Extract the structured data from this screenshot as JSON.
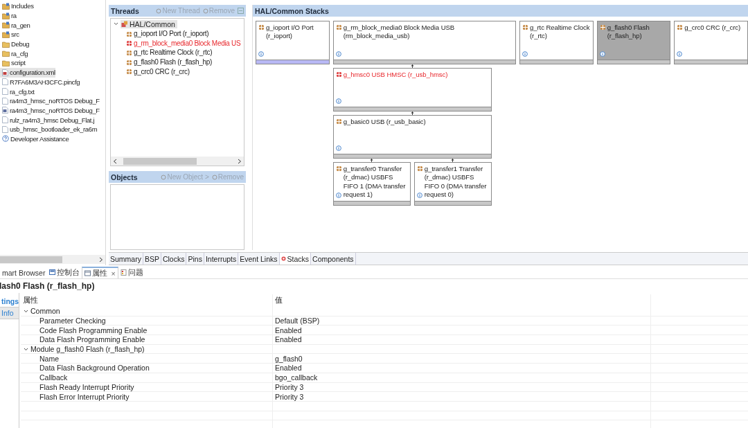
{
  "project_tree": {
    "items": [
      {
        "label": "Includes",
        "kind": "package-folder",
        "selected": false
      },
      {
        "label": "ra",
        "kind": "package-folder",
        "selected": false
      },
      {
        "label": "ra_gen",
        "kind": "package-folder",
        "selected": false
      },
      {
        "label": "src",
        "kind": "package-folder",
        "selected": false
      },
      {
        "label": "Debug",
        "kind": "folder",
        "selected": false
      },
      {
        "label": "ra_cfg",
        "kind": "folder",
        "selected": false
      },
      {
        "label": "script",
        "kind": "folder",
        "selected": false
      },
      {
        "label": "configuration.xml",
        "kind": "config-file",
        "selected": true
      },
      {
        "label": "R7FA6M3AH3CFC.pincfg",
        "kind": "file",
        "selected": false
      },
      {
        "label": "ra_cfg.txt",
        "kind": "file",
        "selected": false
      },
      {
        "label": "ra4m3_hmsc_noRTOS Debug_F",
        "kind": "file",
        "selected": false
      },
      {
        "label": "ra4m3_hmsc_noRTOS Debug_F",
        "kind": "launch-file",
        "selected": false
      },
      {
        "label": "rulz_ra4m3_hmsc Debug_Flat.j",
        "kind": "file",
        "selected": false
      },
      {
        "label": "usb_hmsc_bootloader_ek_ra6m",
        "kind": "file",
        "selected": false
      },
      {
        "label": "Developer Assistance",
        "kind": "help",
        "selected": false
      }
    ]
  },
  "threads": {
    "title": "Threads",
    "actions": [
      {
        "label": "New Thread",
        "disabled": true
      },
      {
        "label": "Remove",
        "disabled": true
      }
    ],
    "tree": {
      "label": "HAL/Common",
      "expanded": true,
      "selected": true,
      "children": [
        {
          "label": "g_ioport I/O Port (r_ioport)",
          "error": false
        },
        {
          "label": "g_rm_block_media0 Block Media US",
          "error": true
        },
        {
          "label": "g_rtc Realtime Clock (r_rtc)",
          "error": false
        },
        {
          "label": "g_flash0 Flash (r_flash_hp)",
          "error": false
        },
        {
          "label": "g_crc0 CRC (r_crc)",
          "error": false
        }
      ]
    }
  },
  "objects": {
    "title": "Objects",
    "actions": [
      {
        "label": "New Object >",
        "disabled": true
      },
      {
        "label": "Remove",
        "disabled": true
      }
    ]
  },
  "stacks": {
    "title": "HAL/Common Stacks",
    "nodes": [
      {
        "label": "g_ioport I/O Port (r_ioport)",
        "error": false,
        "selected": false,
        "color": "#b8b8f4"
      },
      {
        "label": "g_rm_block_media0 Block Media USB (rm_block_media_usb)",
        "error": false,
        "selected": false,
        "color": "#c8c8c8",
        "children": [
          {
            "label": "g_hmsc0 USB HMSC (r_usb_hmsc)",
            "error": true,
            "selected": false,
            "color": "#c8c8c8",
            "children": [
              {
                "label": "g_basic0 USB (r_usb_basic)",
                "error": false,
                "selected": false,
                "color": "#c8c8c8",
                "children": [
                  {
                    "label": "g_transfer0 Transfer (r_dmac) USBFS FIFO 1 (DMA transfer request 1)",
                    "error": false,
                    "selected": false,
                    "color": "#c8c8c8"
                  },
                  {
                    "label": "g_transfer1 Transfer (r_dmac) USBFS FIFO 0 (DMA transfer request 0)",
                    "error": false,
                    "selected": false,
                    "color": "#c8c8c8"
                  }
                ]
              }
            ]
          }
        ]
      },
      {
        "label": "g_rtc Realtime Clock (r_rtc)",
        "error": false,
        "selected": false,
        "color": "#c8c8c8"
      },
      {
        "label": "g_flash0 Flash (r_flash_hp)",
        "error": false,
        "selected": true,
        "color": "#c8c8c8"
      },
      {
        "label": "g_crc0 CRC (r_crc)",
        "error": false,
        "selected": false,
        "color": "#c8c8c8"
      }
    ]
  },
  "editor_tabs": [
    {
      "label": "Summary",
      "selected": false,
      "warning": false
    },
    {
      "label": "BSP",
      "selected": false,
      "warning": false
    },
    {
      "label": "Clocks",
      "selected": false,
      "warning": false
    },
    {
      "label": "Pins",
      "selected": false,
      "warning": false
    },
    {
      "label": "Interrupts",
      "selected": false,
      "warning": false
    },
    {
      "label": "Event Links",
      "selected": false,
      "warning": false
    },
    {
      "label": "Stacks",
      "selected": true,
      "warning": true
    },
    {
      "label": "Components",
      "selected": false,
      "warning": false
    }
  ],
  "view_tabs": [
    {
      "label": "mart Browser",
      "kind": "browser",
      "selected": false
    },
    {
      "label": "控制台",
      "kind": "console",
      "selected": false
    },
    {
      "label": "属性",
      "kind": "properties",
      "selected": true,
      "close": "×"
    },
    {
      "label": "问题",
      "kind": "problems",
      "selected": false
    }
  ],
  "properties": {
    "title": "lash0 Flash (r_flash_hp)",
    "side_tabs": [
      {
        "label": "tings",
        "selected": true
      },
      {
        "label": "Info",
        "selected": false
      }
    ],
    "columns": [
      "属性",
      "值"
    ],
    "sections": [
      {
        "label": "Common",
        "expanded": true,
        "rows": [
          {
            "property": "Parameter Checking",
            "value": "Default (BSP)"
          },
          {
            "property": "Code Flash Programming Enable",
            "value": "Enabled"
          },
          {
            "property": "Data Flash Programming Enable",
            "value": "Enabled"
          }
        ]
      },
      {
        "label": "Module g_flash0 Flash (r_flash_hp)",
        "expanded": true,
        "rows": [
          {
            "property": "Name",
            "value": "g_flash0"
          },
          {
            "property": "Data Flash Background Operation",
            "value": "Enabled"
          },
          {
            "property": "Callback",
            "value": "bgo_callback"
          },
          {
            "property": "Flash Ready Interrupt Priority",
            "value": "Priority 3"
          },
          {
            "property": "Flash Error Interrupt Priority",
            "value": "Priority 3"
          }
        ]
      }
    ]
  }
}
